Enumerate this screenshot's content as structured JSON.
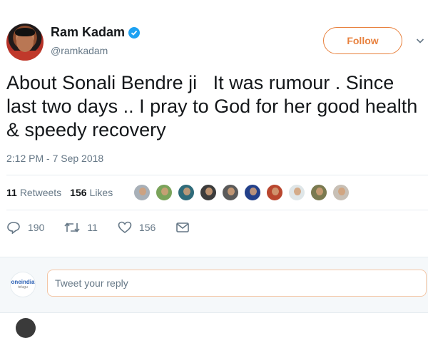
{
  "author": {
    "name": "Ram Kadam",
    "handle": "@ramkadam",
    "verified": true
  },
  "follow_label": "Follow",
  "tweet": {
    "text": "About Sonali Bendre ji   It was rumour . Since last two days .. I pray to God for her good health & speedy recovery",
    "timestamp": "2:12 PM - 7 Sep 2018"
  },
  "stats": {
    "retweets_count": "11",
    "retweets_label": "Retweets",
    "likes_count": "156",
    "likes_label": "Likes"
  },
  "likers": [
    {
      "name": "liker-1",
      "color": "#a8b0b8"
    },
    {
      "name": "liker-2",
      "color": "#7aa35a"
    },
    {
      "name": "liker-3",
      "color": "#2f6b7a"
    },
    {
      "name": "liker-4",
      "color": "#3c3c3c"
    },
    {
      "name": "liker-5",
      "color": "#5a5a5a"
    },
    {
      "name": "liker-6",
      "color": "#23408a"
    },
    {
      "name": "liker-7",
      "color": "#b9462e"
    },
    {
      "name": "liker-8",
      "color": "#dfe6e8"
    },
    {
      "name": "liker-9",
      "color": "#7a7a50"
    },
    {
      "name": "liker-10",
      "color": "#c8c0b6"
    }
  ],
  "actions": {
    "replies": "190",
    "retweets": "11",
    "likes": "156"
  },
  "reply": {
    "placeholder": "Tweet your reply",
    "logo_text": "oneindia",
    "logo_sub": "telugu"
  },
  "colors": {
    "accent_orange": "#e8813e",
    "verified_blue": "#1da1f2",
    "muted_text": "#657786"
  }
}
